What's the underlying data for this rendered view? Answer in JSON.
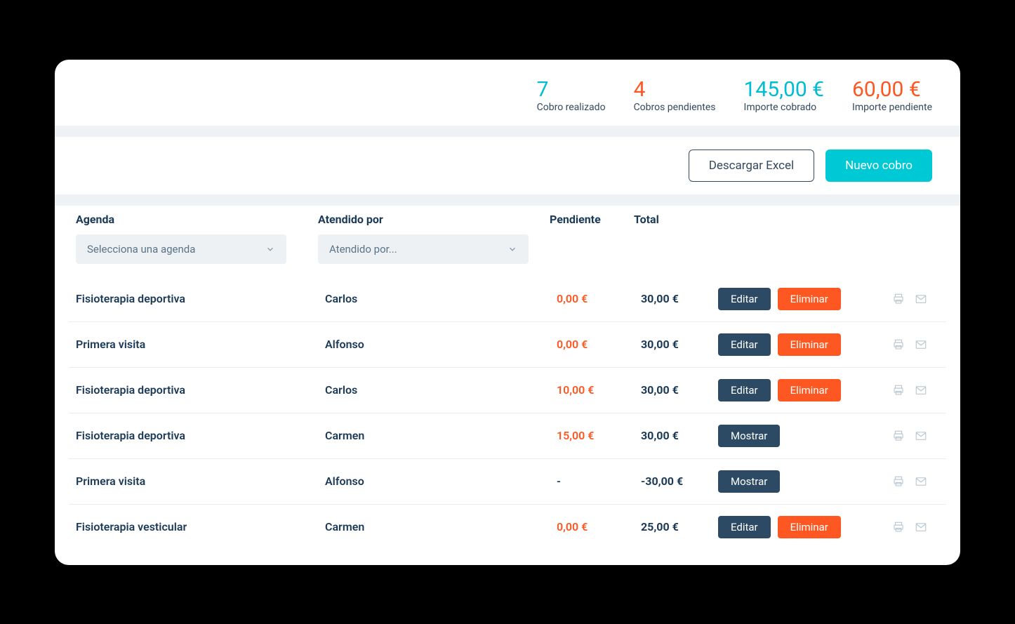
{
  "summary": {
    "cobro_realizado": {
      "value": "7",
      "label": "Cobro realizado"
    },
    "cobros_pendientes": {
      "value": "4",
      "label": "Cobros pendientes"
    },
    "importe_cobrado": {
      "value": "145,00 €",
      "label": "Importe cobrado"
    },
    "importe_pendiente": {
      "value": "60,00 €",
      "label": "Importe pendiente"
    }
  },
  "actions": {
    "download_excel": "Descargar Excel",
    "new_payment": "Nuevo cobro"
  },
  "filters": {
    "agenda_label": "Agenda",
    "agenda_placeholder": "Selecciona una agenda",
    "atendido_label": "Atendido por",
    "atendido_placeholder": "Atendido por..."
  },
  "headers": {
    "pendiente": "Pendiente",
    "total": "Total"
  },
  "buttons": {
    "editar": "Editar",
    "eliminar": "Eliminar",
    "mostrar": "Mostrar"
  },
  "rows": [
    {
      "agenda": "Fisioterapia deportiva",
      "atendido": "Carlos",
      "pendiente": "0,00 €",
      "pendiente_class": "pending-orange",
      "total": "30,00 €",
      "mode": "edit"
    },
    {
      "agenda": "Primera visita",
      "atendido": "Alfonso",
      "pendiente": "0,00 €",
      "pendiente_class": "pending-orange",
      "total": "30,00 €",
      "mode": "edit"
    },
    {
      "agenda": "Fisioterapia deportiva",
      "atendido": "Carlos",
      "pendiente": "10,00 €",
      "pendiente_class": "pending-orange",
      "total": "30,00 €",
      "mode": "edit"
    },
    {
      "agenda": "Fisioterapia deportiva",
      "atendido": "Carmen",
      "pendiente": "15,00 €",
      "pendiente_class": "pending-orange",
      "total": "30,00 €",
      "mode": "show"
    },
    {
      "agenda": "Primera visita",
      "atendido": "Alfonso",
      "pendiente": "-",
      "pendiente_class": "pending-dash",
      "total": "-30,00 €",
      "mode": "show"
    },
    {
      "agenda": "Fisioterapia vesticular",
      "atendido": "Carmen",
      "pendiente": "0,00 €",
      "pendiente_class": "pending-orange",
      "total": "25,00 €",
      "mode": "edit"
    }
  ]
}
